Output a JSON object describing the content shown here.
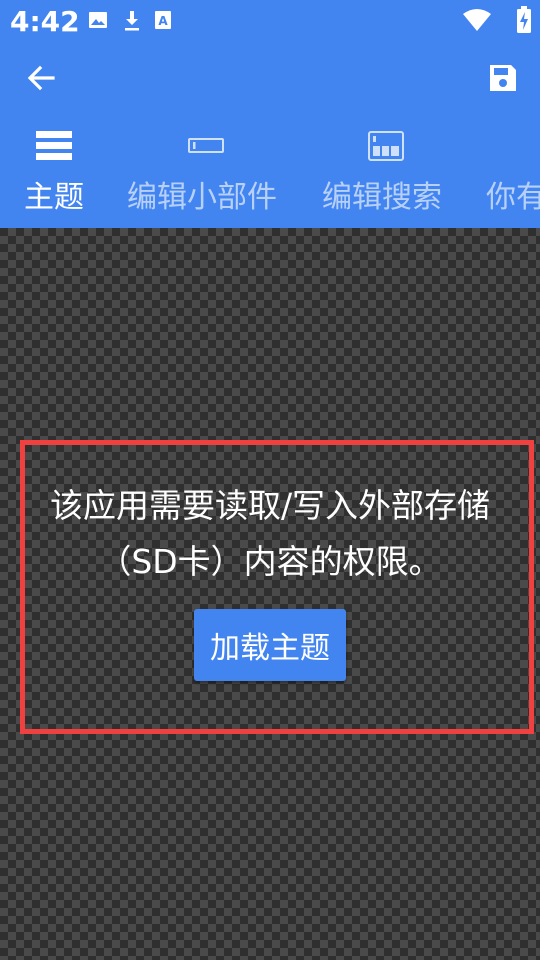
{
  "status_bar": {
    "time": "4:42",
    "icons": [
      "image-icon",
      "download-icon",
      "keyboard-a-icon",
      "wifi-icon",
      "battery-charging-icon"
    ]
  },
  "toolbar": {
    "back_icon": "arrow-left-icon",
    "save_icon": "floppy-disk-icon"
  },
  "tabs": [
    {
      "label": "主题",
      "icon": "list-rows-icon",
      "active": true
    },
    {
      "label": "编辑小部件",
      "icon": "widget-bar-icon",
      "active": false
    },
    {
      "label": "编辑搜索",
      "icon": "grid-search-icon",
      "active": false
    },
    {
      "label": "你有",
      "icon": "",
      "active": false
    }
  ],
  "content": {
    "message_line1": "该应用需要读取/写入外部存储",
    "message_line2": "（SD卡）内容的权限。",
    "load_button_label": "加载主题"
  },
  "colors": {
    "primary": "#4285F0",
    "highlight_border": "#F04040",
    "text_on_primary": "#FFFFFF"
  }
}
